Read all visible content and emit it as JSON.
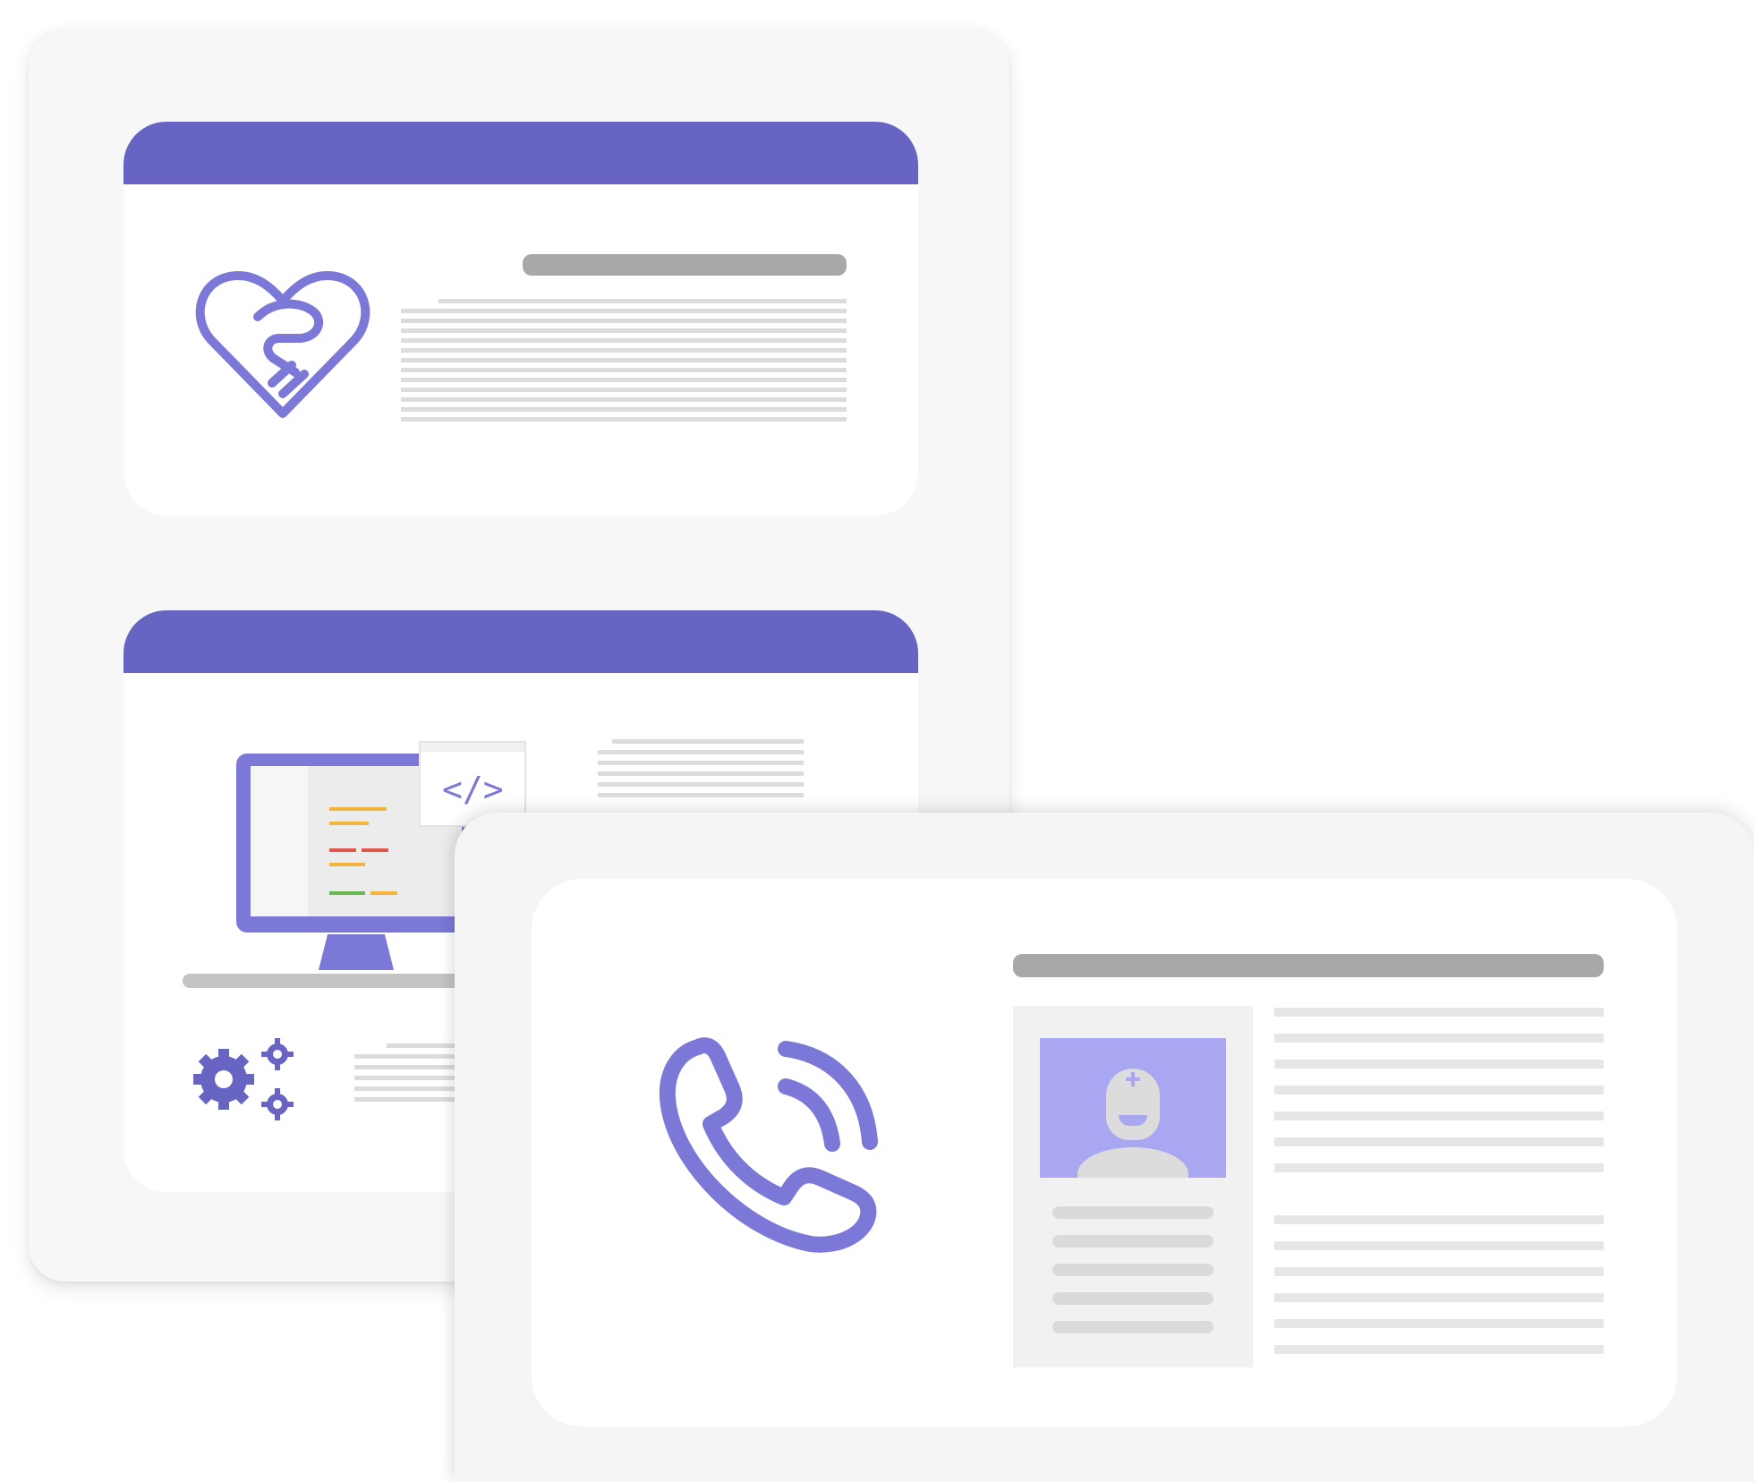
{
  "colors": {
    "accent": "#6764c3",
    "icon": "#7c78d8",
    "avatar_bg": "#a9a6f2",
    "text_placeholder": "#dcdcdc",
    "title_placeholder": "#a8a8a8"
  },
  "icons": {
    "card1": "heart-handshake-icon",
    "card2_main": "monitor-code-icon",
    "card2_secondary": "gears-icon",
    "front_main": "phone-call-icon",
    "front_avatar": "doctor-avatar-icon"
  },
  "code_glyph": "</>"
}
